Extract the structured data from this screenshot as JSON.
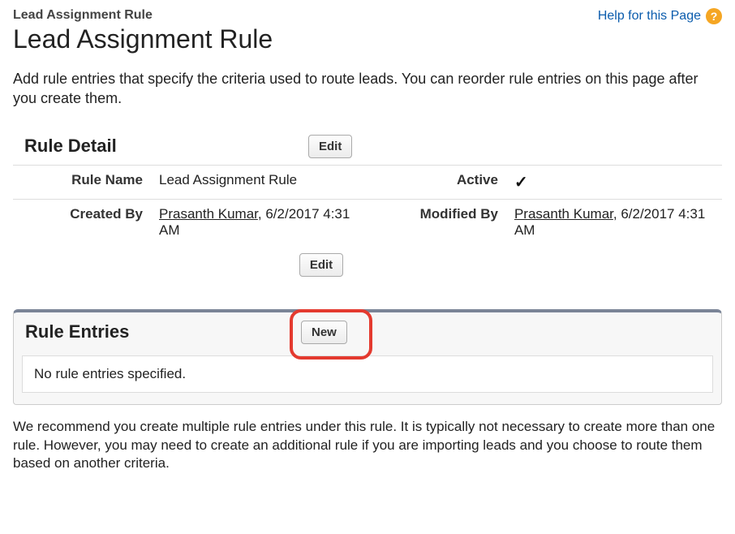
{
  "breadcrumb": "Lead Assignment Rule",
  "page_title": "Lead Assignment Rule",
  "help_link_label": "Help for this Page",
  "help_icon_glyph": "?",
  "intro": "Add rule entries that specify the criteria used to route leads. You can reorder rule entries on this page after you create them.",
  "detail": {
    "section_title": "Rule Detail",
    "edit_label": "Edit",
    "rule_name_label": "Rule Name",
    "rule_name_value": "Lead Assignment Rule",
    "active_label": "Active",
    "active_value": true,
    "created_by_label": "Created By",
    "created_by_user": "Prasanth Kumar",
    "created_by_timestamp": ", 6/2/2017 4:31 AM",
    "modified_by_label": "Modified By",
    "modified_by_user": "Prasanth Kumar",
    "modified_by_timestamp": ", 6/2/2017 4:31 AM"
  },
  "entries": {
    "section_title": "Rule Entries",
    "new_label": "New",
    "empty_text": "No rule entries specified."
  },
  "footer": "We recommend you create multiple rule entries under this rule. It is typically not necessary to create more than one rule. However, you may need to create an additional rule if you are importing leads and you choose to route them based on another criteria."
}
